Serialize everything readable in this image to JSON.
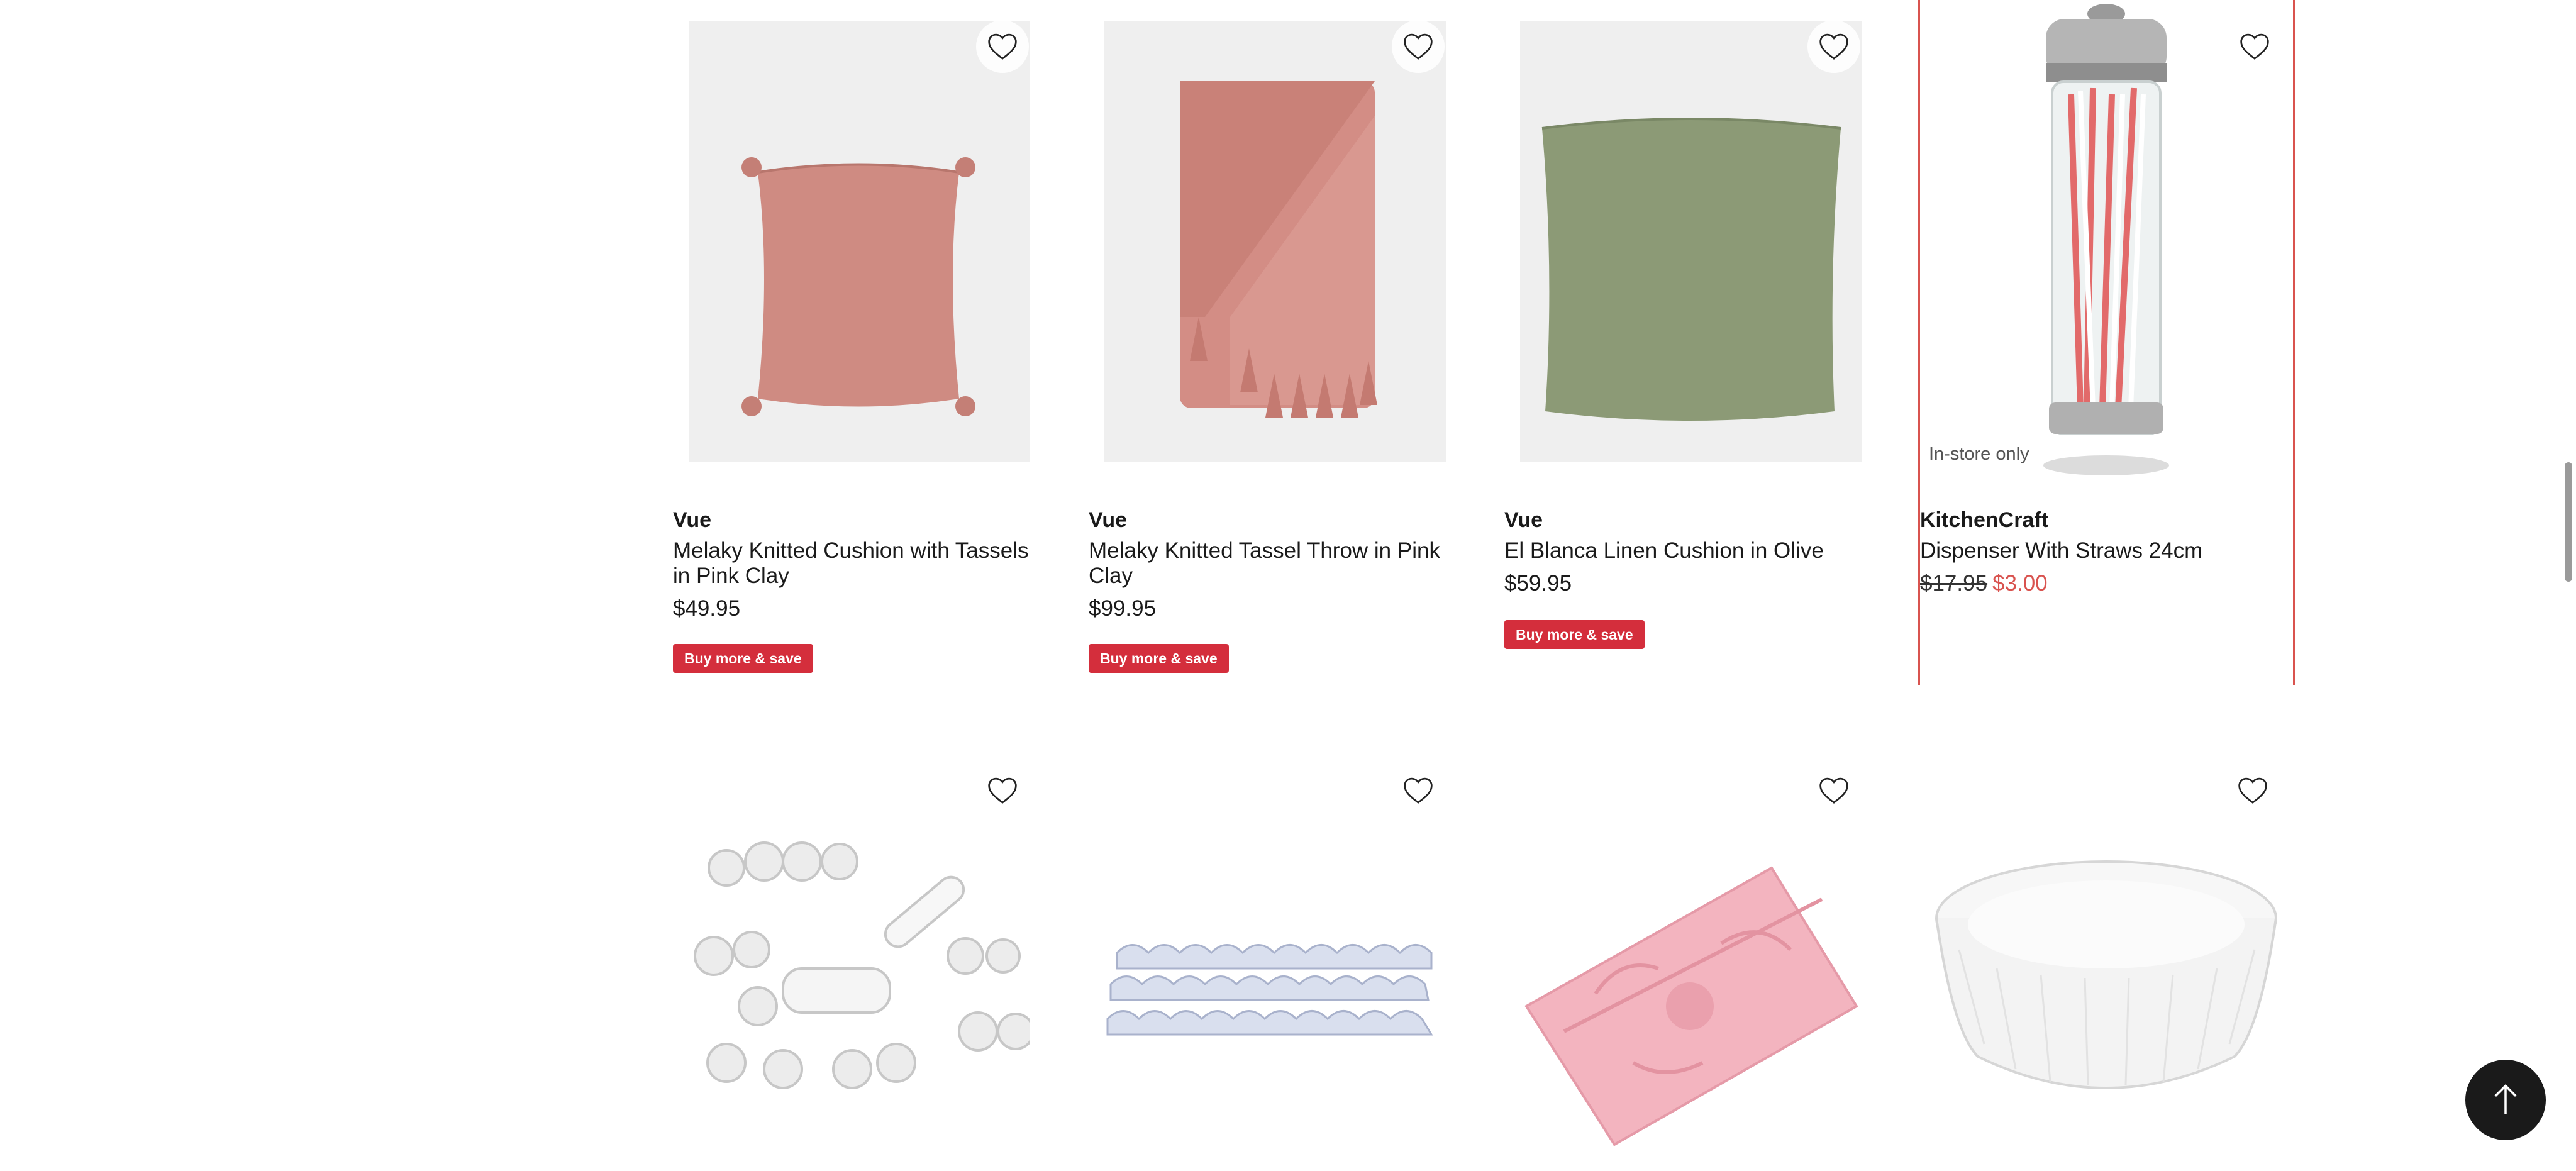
{
  "products": [
    {
      "brand": "Vue",
      "name": "Melaky Knitted Cushion with Tassels in Pink Clay",
      "price": "$49.95",
      "badge": "Buy more & save",
      "image": "pink knitted cushion with tassels"
    },
    {
      "brand": "Vue",
      "name": "Melaky Knitted Tassel Throw in Pink Clay",
      "price": "$99.95",
      "badge": "Buy more & save",
      "image": "pink knitted throw with tassels"
    },
    {
      "brand": "Vue",
      "name": "El Blanca Linen Cushion in Olive",
      "price": "$59.95",
      "badge": "Buy more & save",
      "image": "olive linen cushion"
    },
    {
      "brand": "KitchenCraft",
      "name": "Dispenser With Straws 24cm",
      "price_was": "$17.95",
      "price_now": "$3.00",
      "tag": "In-store only",
      "image": "glass straw dispenser"
    },
    {
      "image": "fondant plunger cutter set"
    },
    {
      "image": "border strip cutters"
    },
    {
      "image": "pink silicone lace mould"
    },
    {
      "image": "white paper baking cases"
    }
  ],
  "icons": {
    "wishlist": "heart-outline-icon",
    "back_to_top": "arrow-up-icon"
  },
  "colors": {
    "badge": "#d42e3c",
    "sale": "#d9534f",
    "highlight_border": "#d9534f"
  }
}
